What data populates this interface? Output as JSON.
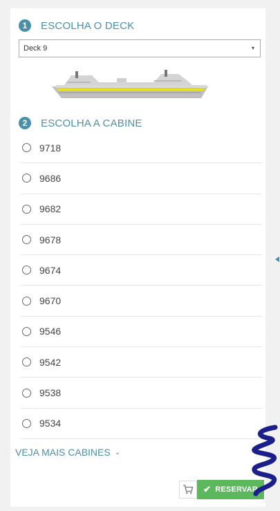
{
  "steps": {
    "deck": {
      "number": "1",
      "title": "ESCOLHA O DECK"
    },
    "cabin": {
      "number": "2",
      "title": "ESCOLHA A CABINE"
    }
  },
  "deck_select": {
    "value": "Deck 9",
    "arrow": "▾"
  },
  "cabins": [
    "9718",
    "9686",
    "9682",
    "9678",
    "9674",
    "9670",
    "9546",
    "9542",
    "9538",
    "9534"
  ],
  "more_link": {
    "label": "VEJA MAIS CABINES",
    "chevron": "⌄"
  },
  "reserve_button": {
    "label": "RESERVAR",
    "check": "✔"
  },
  "colors": {
    "accent": "#4a90a8",
    "button": "#5cb85c",
    "stripe": "#e8e020",
    "chat_spring": "#1a1f8c"
  },
  "icons": {
    "cart": "cart-icon",
    "ship": "ship-image",
    "chat": "chat-widget-icon"
  }
}
